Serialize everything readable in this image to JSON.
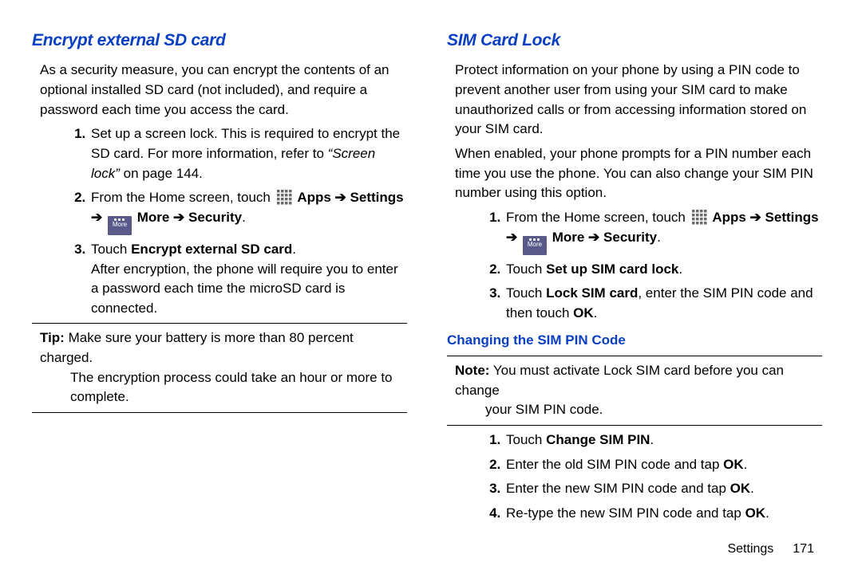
{
  "left": {
    "heading": "Encrypt external SD card",
    "intro": "As a security measure, you can encrypt the contents of an optional installed SD card (not included), and require a password each time you access the card.",
    "step1a": "Set up a screen lock. This is required to encrypt the SD card. For more information, refer to ",
    "step1_ref": "“Screen lock”",
    "step1b": " on page 144.",
    "step2a": "From the Home screen, touch ",
    "apps_label": "Apps",
    "settings_label": "Settings",
    "more_label": "More",
    "security_label": "Security",
    "step3a": "Touch ",
    "step3b": "Encrypt external SD card",
    "step3c": "After encryption, the phone will require you to enter a password each time the microSD card is connected.",
    "tip_label": "Tip:",
    "tip_a": " Make sure your battery is more than 80 percent charged. ",
    "tip_b": "The encryption process could take an hour or more to complete."
  },
  "right": {
    "heading": "SIM Card Lock",
    "p1": "Protect information on your phone by using a PIN code to prevent another user from using your SIM card to make unauthorized calls or from accessing information stored on your SIM card.",
    "p2": "When enabled, your phone prompts for a PIN number each time you use the phone. You can also change your SIM PIN number using this option.",
    "step1a": "From the Home screen, touch ",
    "step2a": "Touch ",
    "step2b": "Set up SIM card lock",
    "step3a": "Touch ",
    "step3b": "Lock SIM card",
    "step3c": ", enter the SIM PIN code and then touch ",
    "ok": "OK",
    "sub_heading": "Changing the SIM PIN Code",
    "note_label": "Note:",
    "note_a": " You must activate Lock SIM card before you can change ",
    "note_b": "your SIM PIN code.",
    "c1a": "Touch ",
    "c1b": "Change SIM PIN",
    "c2": "Enter the old SIM PIN code and tap ",
    "c3": "Enter the new SIM PIN code and tap ",
    "c4": "Re-type the new SIM PIN code and tap "
  },
  "footer": {
    "section": "Settings",
    "page": "171"
  },
  "icon": {
    "more_text": "More"
  }
}
